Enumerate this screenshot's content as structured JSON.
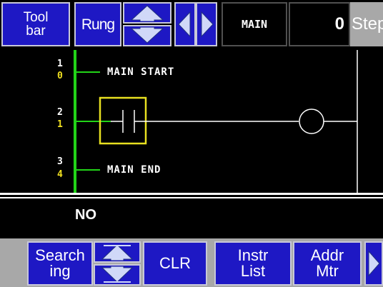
{
  "top_bar": {
    "toolbar_line1": "Tool",
    "toolbar_line2": "bar",
    "rung_label": "Rung",
    "program_name": "MAIN",
    "step_value": "0",
    "step_label": "Step"
  },
  "ladder": {
    "rungs": [
      {
        "rung_no": "1",
        "step_no": "0",
        "text": "MAIN START"
      },
      {
        "rung_no": "2",
        "step_no": "1",
        "text": ""
      },
      {
        "rung_no": "3",
        "step_no": "4",
        "text": "MAIN END"
      }
    ]
  },
  "status": {
    "text": "NO"
  },
  "bottom_bar": {
    "search_line1": "Search",
    "search_line2": "ing",
    "clr_label": "CLR",
    "instr_line1": "Instr",
    "instr_line2": "List",
    "addr_line1": "Addr",
    "addr_line2": "Mtr"
  },
  "colors": {
    "button_blue": "#1e18c4",
    "power_rail_green": "#22d418",
    "cursor_yellow": "#e8e020",
    "step_number_yellow": "#f0e020"
  }
}
